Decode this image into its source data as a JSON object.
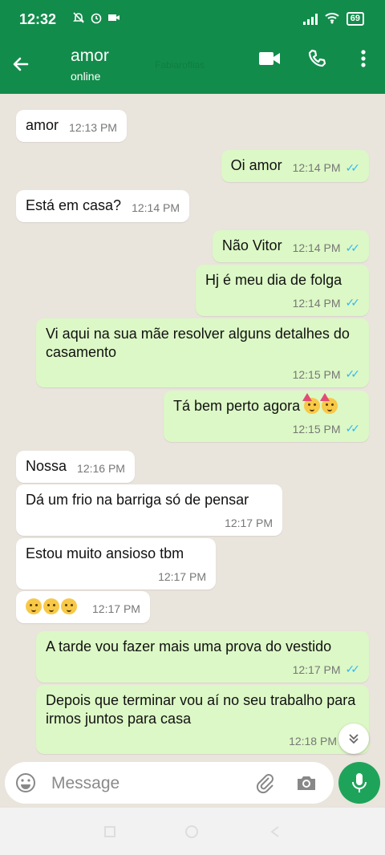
{
  "status_bar": {
    "time": "12:32",
    "battery": "69"
  },
  "header": {
    "contact_name": "amor",
    "status": "online",
    "faded_text": "Fabiaroflias"
  },
  "messages": [
    {
      "direction": "in",
      "text": "amor",
      "time": "12:13 PM"
    },
    {
      "direction": "out",
      "text": "Oi amor",
      "time": "12:14 PM"
    },
    {
      "direction": "in",
      "text": "Está em casa?",
      "time": "12:14 PM"
    },
    {
      "direction": "out",
      "text": "Não Vitor",
      "time": "12:14 PM"
    },
    {
      "direction": "out",
      "text": "Hj é meu dia de folga",
      "time": "12:14 PM"
    },
    {
      "direction": "out",
      "text": "Vi aqui na sua mãe resolver alguns detalhes do casamento",
      "time": "12:15 PM"
    },
    {
      "direction": "out",
      "text": "Tá bem perto agora",
      "time": "12:15 PM"
    },
    {
      "direction": "in",
      "text": "Nossa",
      "time": "12:16 PM"
    },
    {
      "direction": "in",
      "text": "Dá um frio na barriga só de pensar",
      "time": "12:17 PM"
    },
    {
      "direction": "in",
      "text": "Estou muito ansioso tbm",
      "time": "12:17 PM"
    },
    {
      "direction": "in",
      "text": "",
      "time": "12:17 PM"
    },
    {
      "direction": "out",
      "text": "A tarde vou fazer mais uma prova do vestido",
      "time": "12:17 PM"
    },
    {
      "direction": "out",
      "text": "Depois que terminar vou aí no seu trabalho para irmos juntos para casa",
      "time": "12:18 PM"
    }
  ],
  "input": {
    "placeholder": "Message"
  },
  "colors": {
    "header": "#128c4b",
    "outgoing_bubble": "#dcf8c6",
    "incoming_bubble": "#ffffff",
    "mic_button": "#1ea45a",
    "read_ticks": "#34b7f1"
  },
  "icons": [
    "back-arrow-icon",
    "video-call-icon",
    "phone-icon",
    "more-options-icon",
    "scroll-down-icon",
    "emoji-icon",
    "attach-icon",
    "camera-icon",
    "mic-icon"
  ]
}
